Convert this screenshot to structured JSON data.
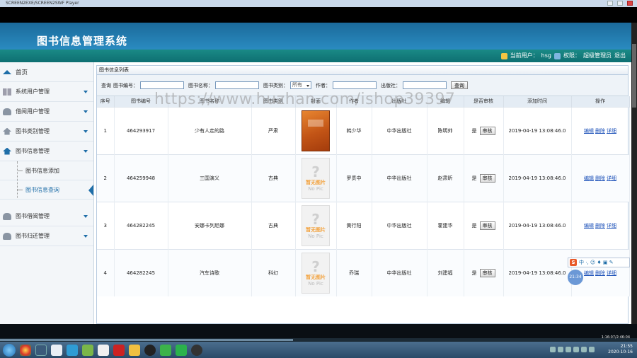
{
  "player": {
    "title": "SCREEN2EXE/SCREEN2SWF Player",
    "progress": 0.46,
    "time_label": "1:16:07/2:46:04"
  },
  "app": {
    "title": "图书信息管理系统",
    "userbar": {
      "user_label": "当前用户：",
      "user": "hsg",
      "role_label": "权限：",
      "role": "超级管理员",
      "logout": "退出"
    }
  },
  "sidebar": {
    "home": "首页",
    "items": [
      {
        "label": "系统用户管理"
      },
      {
        "label": "借阅用户管理"
      },
      {
        "label": "图书类别管理"
      },
      {
        "label": "图书信息管理"
      },
      {
        "label": "图书信息添加"
      },
      {
        "label": "图书信息查询"
      },
      {
        "label": "图书借阅管理"
      },
      {
        "label": "图书归还管理"
      }
    ]
  },
  "panel": {
    "title": "图书信息列表"
  },
  "search": {
    "label": "查询",
    "book_no_label": "图书编号：",
    "book_name_label": "图书名称：",
    "category_label": "图书类别：",
    "category_value": "所有",
    "author_label": "作者：",
    "publisher_label": "出版社：",
    "button": "查询"
  },
  "table": {
    "headers": [
      "序号",
      "图书编号",
      "图书名称",
      "图书类别",
      "封面",
      "作者",
      "出版社",
      "编辑",
      "是否审核",
      "添加时间",
      "操作"
    ],
    "rows": [
      {
        "idx": "1",
        "no": "464293917",
        "name": "少有人走的路",
        "cat": "严肃",
        "cover": "book",
        "author": "韩少华",
        "pub": "中华出版社",
        "editor": "陈明帅",
        "audited": "是",
        "time": "2019-04-19 13:08:46.0"
      },
      {
        "idx": "2",
        "no": "464259948",
        "name": "三国演义",
        "cat": "古典",
        "cover": "nopic",
        "author": "罗贯中",
        "pub": "中华出版社",
        "editor": "赵肃昕",
        "audited": "是",
        "time": "2019-04-19 13:08:46.0"
      },
      {
        "idx": "3",
        "no": "464282245",
        "name": "安娜卡列尼娜",
        "cat": "古典",
        "cover": "nopic",
        "author": "黄行阳",
        "pub": "中华出版社",
        "editor": "霍建华",
        "audited": "是",
        "time": "2019-04-19 13:08:46.0"
      },
      {
        "idx": "4",
        "no": "464282245",
        "name": "汽车诗歌",
        "cat": "科幻",
        "cover": "nopic",
        "author": "乔瑞",
        "pub": "中华出版社",
        "editor": "刘建福",
        "audited": "是",
        "time": "2019-04-19 13:08:46.0"
      }
    ],
    "audit_btn": "审核",
    "ops": [
      "编辑",
      "删除",
      "详细"
    ],
    "nopic_text1": "暂无图片",
    "nopic_text2": "No Pic"
  },
  "watermark": "https://www.huzhan.com/ishop39397",
  "ime": {
    "logo": "S",
    "text": "中 ·, ☺ ♦ ▣ ✎"
  },
  "clock_bubble": "21:34",
  "taskbar": {
    "time": "21:55",
    "date": "2020-10-16"
  }
}
